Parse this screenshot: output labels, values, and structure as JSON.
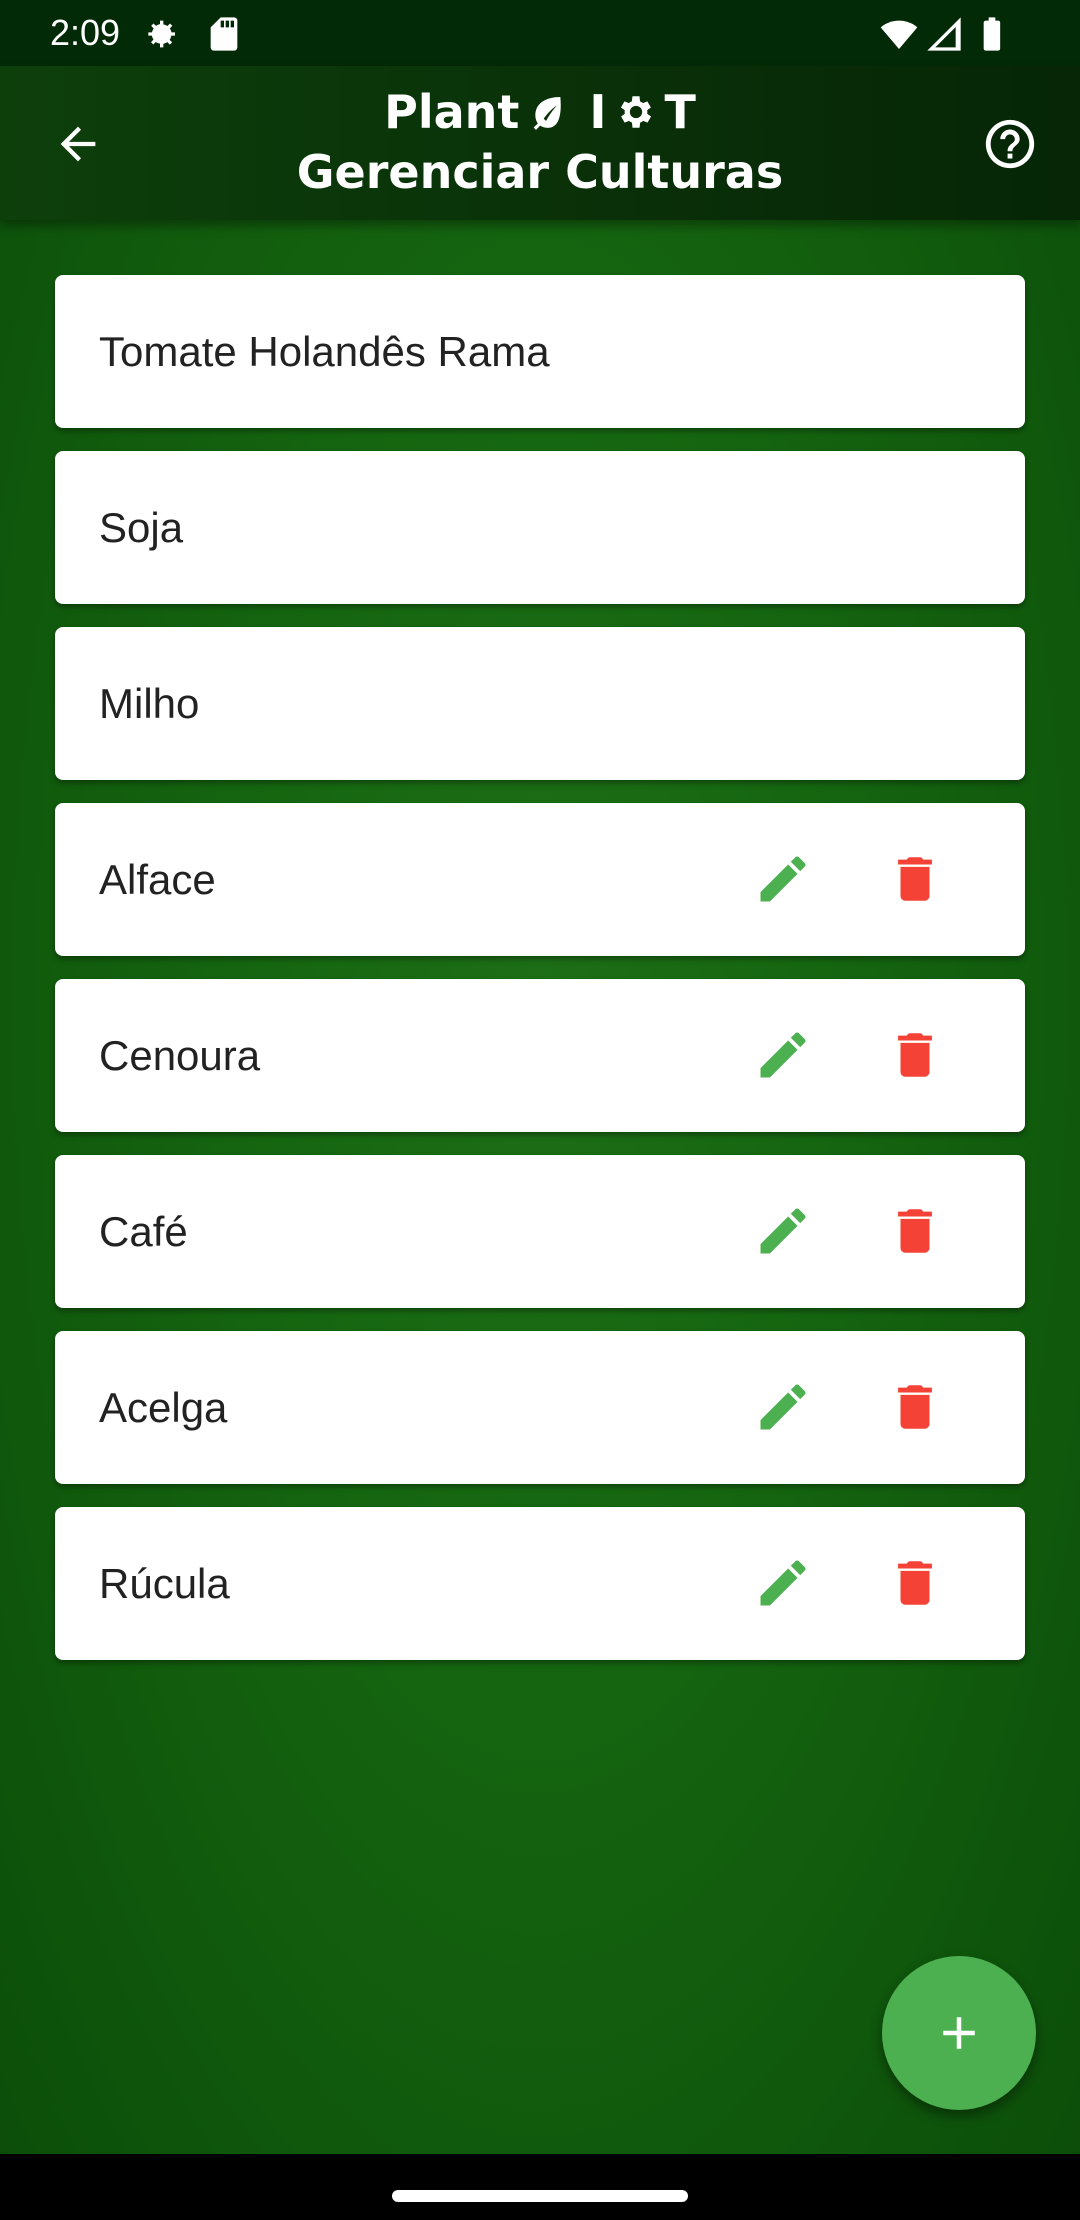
{
  "status_bar": {
    "time": "2:09",
    "icons": [
      "settings-gear-icon",
      "sd-card-icon",
      "wifi-icon",
      "signal-icon",
      "battery-icon"
    ]
  },
  "app_bar": {
    "title_line1_left": "Plant",
    "title_line1_right": "I",
    "title_line1_end": "T",
    "title_line2": "Gerenciar Culturas",
    "back_icon": "arrow-left-icon",
    "help_icon": "help-circle-icon"
  },
  "crops": [
    {
      "name": "Tomate Holandês Rama",
      "editable": false
    },
    {
      "name": "Soja",
      "editable": false
    },
    {
      "name": "Milho",
      "editable": false
    },
    {
      "name": "Alface",
      "editable": true
    },
    {
      "name": "Cenoura",
      "editable": true
    },
    {
      "name": "Café",
      "editable": true
    },
    {
      "name": "Acelga",
      "editable": true
    },
    {
      "name": "Rúcula",
      "editable": true
    }
  ],
  "colors": {
    "edit": "#4caf50",
    "delete": "#f44336",
    "fab": "#4caf50",
    "app_bar": "#0a350a"
  },
  "fab": {
    "icon": "plus-icon"
  }
}
